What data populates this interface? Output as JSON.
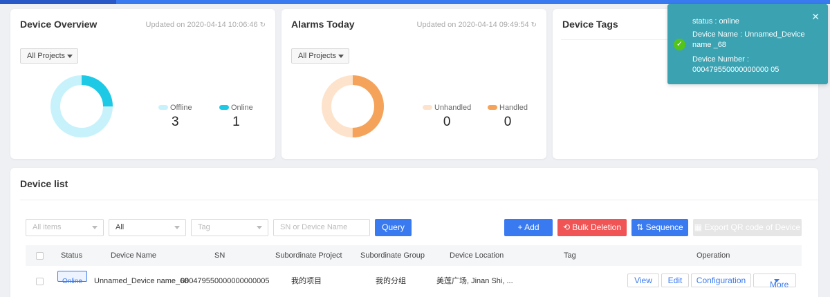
{
  "colors": {
    "primary": "#3a7af0",
    "danger": "#f05454",
    "online": "#1ec9e6",
    "offline": "#c8f2fb",
    "handled": "#f5a35a",
    "unhandled": "#fde3cc",
    "toast_bg": "#3ba2b2",
    "success": "#52c41a"
  },
  "overview": {
    "title": "Device Overview",
    "updated": "Updated on 2020-04-14 10:06:46",
    "project_select": "All Projects",
    "legend": [
      {
        "label": "Offline",
        "value": "3",
        "count": 3,
        "color": "#c8f2fb"
      },
      {
        "label": "Online",
        "value": "1",
        "count": 1,
        "color": "#1ec9e6"
      }
    ]
  },
  "alarms": {
    "title": "Alarms Today",
    "updated": "Updated on 2020-04-14 09:49:54",
    "project_select": "All Projects",
    "legend": [
      {
        "label": "Unhandled",
        "value": "0",
        "count": 0,
        "color": "#fde3cc"
      },
      {
        "label": "Handled",
        "value": "0",
        "count": 0,
        "color": "#f5a35a"
      }
    ]
  },
  "tags": {
    "title": "Device Tags"
  },
  "toast": {
    "status": "status : online",
    "device_name": "Device Name : Unnamed_Device name _68",
    "device_number": "Device Number : 000479550000000000 05",
    "close_icon": "close-icon",
    "success_icon": "check-circle-icon"
  },
  "device_list": {
    "title": "Device list",
    "filters": {
      "items_placeholder": "All items",
      "status_value": "All",
      "tag_placeholder": "Tag",
      "search_placeholder": "SN or Device Name"
    },
    "buttons": {
      "query": "Query",
      "add": "Add",
      "bulk_delete": "Bulk Deletion",
      "sequence": "Sequence",
      "export_qr": "Export QR code of Device"
    },
    "columns": [
      "Status",
      "Device Name",
      "SN",
      "Subordinate Project",
      "Subordinate Group",
      "Device Location",
      "Tag",
      "Operation"
    ],
    "rows": [
      {
        "status": "Online",
        "name": "Unnamed_Device name_68",
        "sn": "000479550000000000005",
        "project": "我的项目",
        "group": "我的分组",
        "location": "美莲广场, Jinan Shi, ...",
        "tag": "",
        "actions": [
          "View",
          "Edit",
          "Configuration",
          "More"
        ]
      }
    ]
  }
}
